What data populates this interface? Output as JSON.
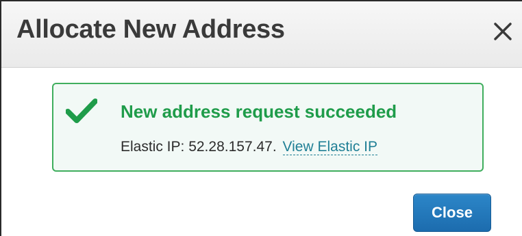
{
  "dialog": {
    "title": "Allocate New Address",
    "close_icon": "close-icon"
  },
  "alert": {
    "icon": "checkmark-icon",
    "title": "New address request succeeded",
    "detail_prefix": "Elastic IP: 52.28.157.47.",
    "link_label": "View Elastic IP"
  },
  "footer": {
    "close_label": "Close"
  },
  "colors": {
    "success": "#1f9c4a",
    "alert_border": "#3fae5d",
    "alert_background": "#f2f9f6",
    "link": "#1f7f95",
    "primary_button": "#1c6cae"
  }
}
